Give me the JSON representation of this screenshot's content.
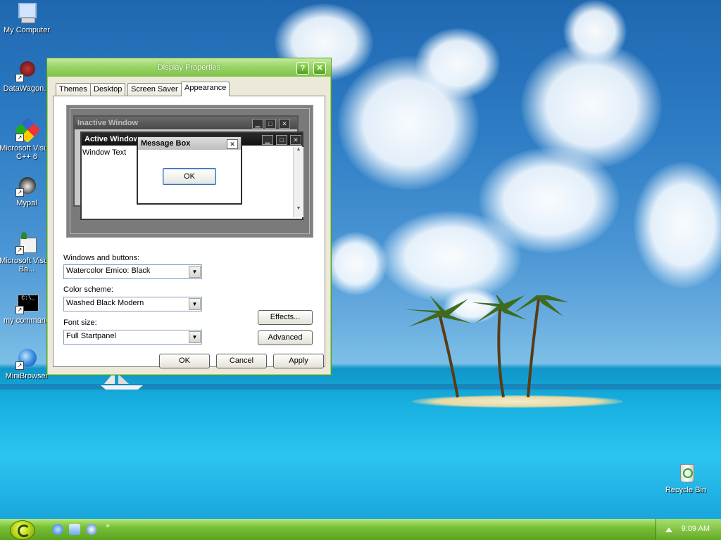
{
  "desktop": {
    "icons": [
      {
        "label": "My Computer"
      },
      {
        "label": "DataWagon..."
      },
      {
        "label": "Microsoft Visual C++ 6"
      },
      {
        "label": "Mypal"
      },
      {
        "label": "Microsoft Visual Ba..."
      },
      {
        "label": "my command"
      },
      {
        "label": "MiniBrowser"
      },
      {
        "label": "Recycle Bin"
      }
    ]
  },
  "dialog": {
    "title": "Display Properties",
    "help_label": "?",
    "close_label": "✕",
    "tabs": [
      {
        "label": "Themes"
      },
      {
        "label": "Desktop"
      },
      {
        "label": "Screen Saver"
      },
      {
        "label": "Appearance"
      }
    ],
    "active_tab": "Appearance",
    "preview": {
      "inactive_window": "Inactive Window",
      "active_window": "Active Window",
      "window_text": "Window Text",
      "message_box": "Message Box",
      "ok": "OK"
    },
    "windows_and_buttons": {
      "label": "Windows and buttons:",
      "value": "Watercolor Emico: Black"
    },
    "color_scheme": {
      "label": "Color scheme:",
      "value": "Washed Black Modern"
    },
    "font_size": {
      "label": "Font size:",
      "value": "Full Startpanel"
    },
    "effects_label": "Effects...",
    "advanced_label": "Advanced",
    "ok_label": "OK",
    "cancel_label": "Cancel",
    "apply_label": "Apply"
  },
  "taskbar": {
    "clock": "9:09 AM",
    "chevron": "»"
  },
  "colors": {
    "titlebar": "#7ec24a",
    "taskbar": "#5ca220",
    "dialog_bg": "#ece9d8"
  }
}
